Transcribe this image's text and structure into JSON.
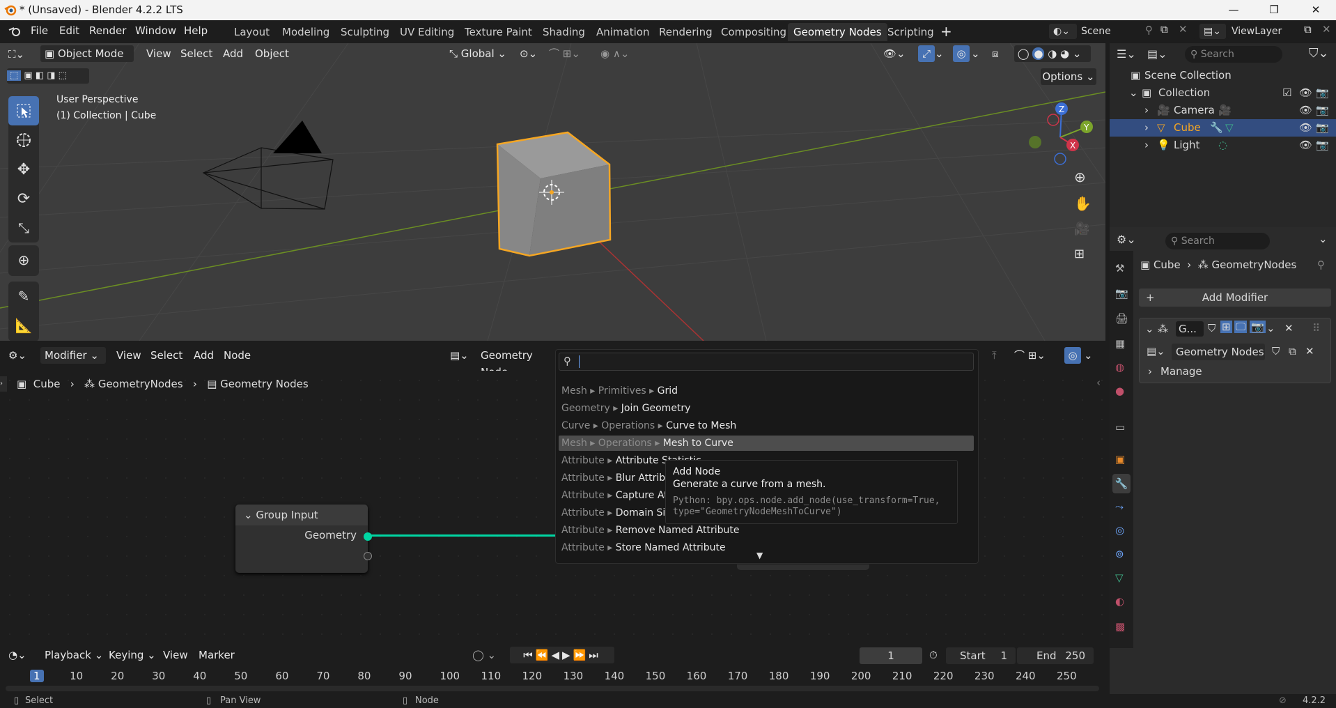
{
  "window": {
    "title": "* (Unsaved) - Blender 4.2.2 LTS",
    "minimize": "—",
    "maximize": "❐",
    "close": "✕"
  },
  "menu": [
    "File",
    "Edit",
    "Render",
    "Window",
    "Help"
  ],
  "workspaces": [
    "Layout",
    "Modeling",
    "Sculpting",
    "UV Editing",
    "Texture Paint",
    "Shading",
    "Animation",
    "Rendering",
    "Compositing",
    "Geometry Nodes",
    "Scripting"
  ],
  "active_workspace": "Geometry Nodes",
  "scene": {
    "name": "Scene",
    "view_layer": "ViewLayer"
  },
  "viewport": {
    "mode": "Object Mode",
    "menus": [
      "View",
      "Select",
      "Add",
      "Object"
    ],
    "orientation": "Global",
    "options": "Options",
    "overlay_line1": "User Perspective",
    "overlay_line2": "(1) Collection | Cube",
    "gizmo": {
      "x": "X",
      "y": "Y",
      "z": "Z"
    }
  },
  "outliner": {
    "search_placeholder": "Search",
    "root": "Scene Collection",
    "collection": "Collection",
    "items": [
      {
        "name": "Camera",
        "selected": false
      },
      {
        "name": "Cube",
        "selected": true
      },
      {
        "name": "Light",
        "selected": false
      }
    ]
  },
  "properties": {
    "search_placeholder": "Search",
    "breadcrumb": [
      "Cube",
      "GeometryNodes"
    ],
    "add_modifier": "Add Modifier",
    "modifier_short": "G...",
    "node_group": "Geometry Nodes",
    "manage": "Manage"
  },
  "node_editor": {
    "editor_type": "Modifier",
    "menus": [
      "View",
      "Select",
      "Add",
      "Node"
    ],
    "tree_name": "Geometry Node",
    "breadcrumb": [
      "Cube",
      "GeometryNodes",
      "Geometry Nodes"
    ],
    "group_input": {
      "title": "Group Input",
      "socket": "Geometry"
    }
  },
  "search_popup": {
    "query": "",
    "results": [
      {
        "path": "Mesh ▸ Primitives ▸ ",
        "name": "Grid"
      },
      {
        "path": "Geometry ▸ ",
        "name": "Join Geometry"
      },
      {
        "path": "Curve ▸ Operations ▸ ",
        "name": "Curve to Mesh"
      },
      {
        "path": "Mesh ▸ Operations ▸ ",
        "name": "Mesh to Curve"
      },
      {
        "path": "Attribute ▸ ",
        "name": "Attribute Statistic"
      },
      {
        "path": "Attribute ▸ ",
        "name": "Blur Attribute"
      },
      {
        "path": "Attribute ▸ ",
        "name": "Capture Attribute"
      },
      {
        "path": "Attribute ▸ ",
        "name": "Domain Size"
      },
      {
        "path": "Attribute ▸ ",
        "name": "Remove Named Attribute"
      },
      {
        "path": "Attribute ▸ ",
        "name": "Store Named Attribute"
      }
    ],
    "highlighted_index": 3
  },
  "tooltip": {
    "title": "Add Node",
    "description": "Generate a curve from a mesh.",
    "python_line1": "Python: bpy.ops.node.add_node(use_transform=True,",
    "python_line2": "type=\"GeometryNodeMeshToCurve\")"
  },
  "timeline": {
    "menus": [
      "Playback",
      "Keying",
      "View",
      "Marker"
    ],
    "current_frame": "1",
    "start_label": "Start",
    "start": "1",
    "end_label": "End",
    "end": "250",
    "ruler": [
      "1",
      "10",
      "20",
      "30",
      "40",
      "50",
      "60",
      "70",
      "80",
      "90",
      "100",
      "110",
      "120",
      "130",
      "140",
      "150",
      "160",
      "170",
      "180",
      "190",
      "200",
      "210",
      "220",
      "230",
      "240",
      "250"
    ]
  },
  "statusbar": {
    "select": "Select",
    "pan": "Pan View",
    "node": "Node",
    "version": "4.2.2"
  },
  "colors": {
    "accent_blue": "#4772b3",
    "selection_orange": "#f5a623",
    "socket_green": "#00d6a3",
    "outliner_selected": "#334d80"
  }
}
